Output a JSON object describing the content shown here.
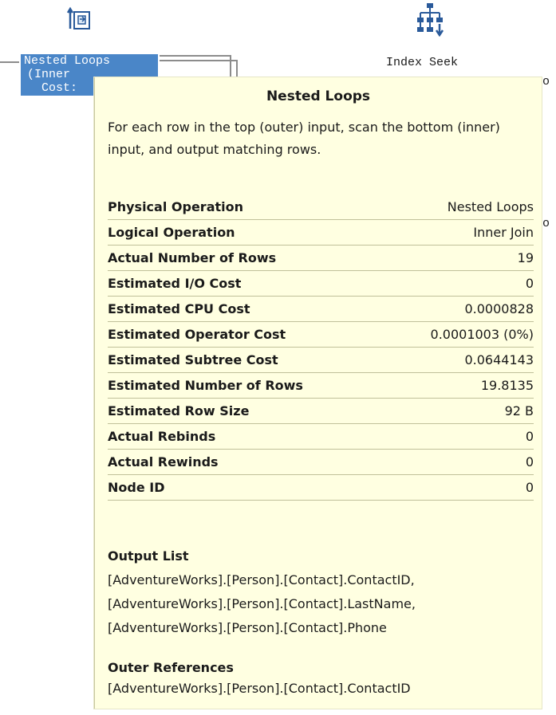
{
  "plan": {
    "nested_loops_node": {
      "line1": "Nested Loops",
      "line2": "(Inner",
      "line3": "Cost:",
      "icon": "nested-loops-icon"
    },
    "index_seek_node": {
      "label": "Index Seek",
      "icon": "index-seek-icon"
    },
    "cut_glyph_1": "o",
    "cut_glyph_2": "o"
  },
  "tooltip": {
    "title": "Nested Loops",
    "description": "For each row in the top (outer) input, scan the bottom (inner) input, and output matching rows.",
    "properties": [
      {
        "key": "Physical Operation",
        "value": "Nested Loops"
      },
      {
        "key": "Logical Operation",
        "value": "Inner Join"
      },
      {
        "key": "Actual Number of Rows",
        "value": "19"
      },
      {
        "key": "Estimated I/O Cost",
        "value": "0"
      },
      {
        "key": "Estimated CPU Cost",
        "value": "0.0000828"
      },
      {
        "key": "Estimated Operator Cost",
        "value": "0.0001003 (0%)"
      },
      {
        "key": "Estimated Subtree Cost",
        "value": "0.0644143"
      },
      {
        "key": "Estimated Number of Rows",
        "value": "19.8135"
      },
      {
        "key": "Estimated Row Size",
        "value": "92 B"
      },
      {
        "key": "Actual Rebinds",
        "value": "0"
      },
      {
        "key": "Actual Rewinds",
        "value": "0"
      },
      {
        "key": "Node ID",
        "value": "0"
      }
    ],
    "output_list_heading": "Output List",
    "output_list": [
      "[AdventureWorks].[Person].[Contact].ContactID,",
      "[AdventureWorks].[Person].[Contact].LastName,",
      "[AdventureWorks].[Person].[Contact].Phone"
    ],
    "outer_references_heading": "Outer References",
    "outer_references": [
      "[AdventureWorks].[Person].[Contact].ContactID"
    ]
  },
  "colors": {
    "node_selected": "#4a86c8",
    "tooltip_bg": "#ffffe1",
    "row_rule": "#c0c09a"
  }
}
